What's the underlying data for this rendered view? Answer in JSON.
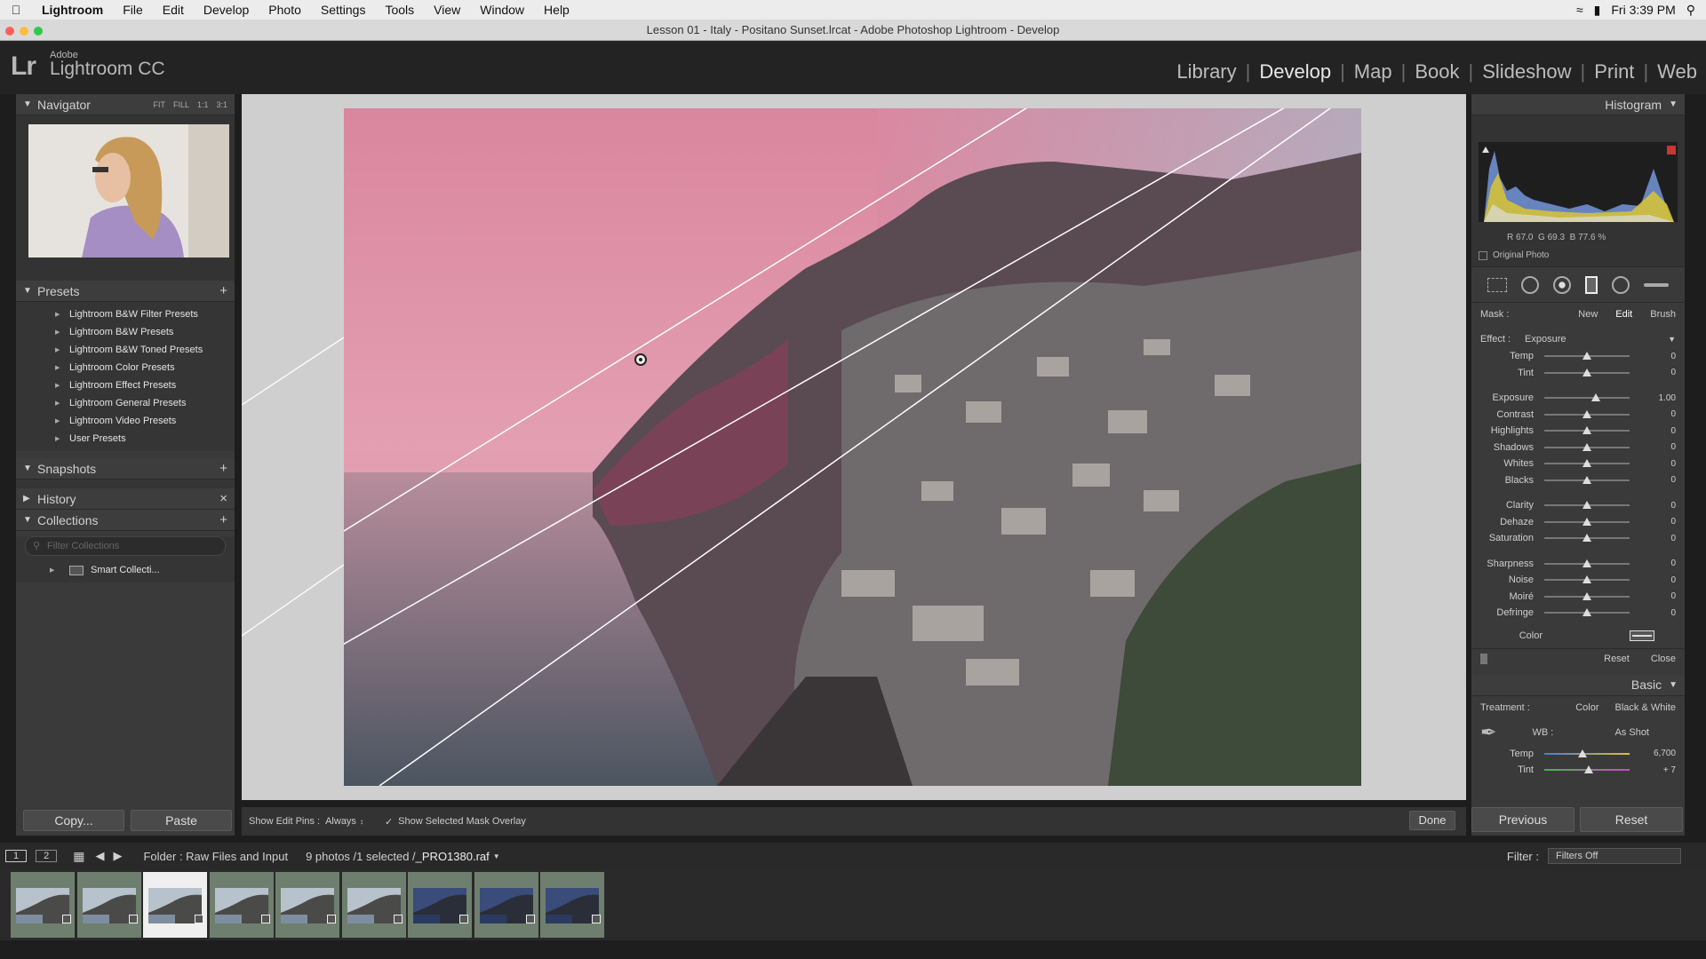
{
  "menubar": {
    "app": "Lightroom",
    "items": [
      "File",
      "Edit",
      "Develop",
      "Photo",
      "Settings",
      "Tools",
      "View",
      "Window",
      "Help"
    ],
    "clock": "Fri 3:39 PM"
  },
  "window": {
    "title": "Lesson 01 - Italy - Positano Sunset.lrcat - Adobe Photoshop Lightroom - Develop"
  },
  "header": {
    "logo": "Lr",
    "adobe": "Adobe",
    "product": "Lightroom CC",
    "modules": [
      "Library",
      "Develop",
      "Map",
      "Book",
      "Slideshow",
      "Print",
      "Web"
    ],
    "active_module": "Develop"
  },
  "left": {
    "navigator": {
      "title": "Navigator",
      "zoom": [
        "FIT",
        "FILL",
        "1:1",
        "3:1"
      ]
    },
    "presets": {
      "title": "Presets",
      "items": [
        "Lightroom B&W Filter Presets",
        "Lightroom B&W Presets",
        "Lightroom B&W Toned Presets",
        "Lightroom Color Presets",
        "Lightroom Effect Presets",
        "Lightroom General Presets",
        "Lightroom Video Presets",
        "User Presets"
      ]
    },
    "snapshots": "Snapshots",
    "history": "History",
    "collections": {
      "title": "Collections",
      "search_placeholder": "Filter Collections",
      "item": "Smart Collecti..."
    },
    "copy_label": "Copy...",
    "paste_label": "Paste"
  },
  "toolbar": {
    "show_pins_label": "Show Edit Pins :",
    "show_pins_value": "Always",
    "overlay_label": "Show Selected Mask Overlay",
    "done_label": "Done"
  },
  "right": {
    "histogram": {
      "title": "Histogram",
      "r": "67.0",
      "g": "69.3",
      "b": "77.6 %",
      "original_photo": "Original Photo"
    },
    "mask": {
      "label": "Mask :",
      "new": "New",
      "edit": "Edit",
      "brush": "Brush"
    },
    "effect": {
      "label": "Effect :",
      "value": "Exposure"
    },
    "sliders": [
      {
        "label": "Temp",
        "value": "0",
        "pos": 0.5
      },
      {
        "label": "Tint",
        "value": "0",
        "pos": 0.5
      },
      {
        "label": "Exposure",
        "value": "1.00",
        "pos": 0.6
      },
      {
        "label": "Contrast",
        "value": "0",
        "pos": 0.5
      },
      {
        "label": "Highlights",
        "value": "0",
        "pos": 0.5
      },
      {
        "label": "Shadows",
        "value": "0",
        "pos": 0.5
      },
      {
        "label": "Whites",
        "value": "0",
        "pos": 0.5
      },
      {
        "label": "Blacks",
        "value": "0",
        "pos": 0.5
      },
      {
        "label": "Clarity",
        "value": "0",
        "pos": 0.5
      },
      {
        "label": "Dehaze",
        "value": "0",
        "pos": 0.5
      },
      {
        "label": "Saturation",
        "value": "0",
        "pos": 0.5
      },
      {
        "label": "Sharpness",
        "value": "0",
        "pos": 0.5
      },
      {
        "label": "Noise",
        "value": "0",
        "pos": 0.5
      },
      {
        "label": "Moiré",
        "value": "0",
        "pos": 0.5
      },
      {
        "label": "Defringe",
        "value": "0",
        "pos": 0.5
      }
    ],
    "color_label": "Color",
    "reset_label": "Reset",
    "close_label": "Close",
    "basic": {
      "title": "Basic",
      "treatment_label": "Treatment :",
      "color": "Color",
      "bw": "Black & White",
      "wb_label": "WB :",
      "wb_value": "As Shot",
      "temp_label": "Temp",
      "temp_value": "6,700",
      "tint_label": "Tint",
      "tint_value": "+ 7"
    },
    "previous_label": "Previous",
    "reset_btn_label": "Reset"
  },
  "filmstrip": {
    "page1": "1",
    "page2": "2",
    "folder": "Folder : Raw Files and Input",
    "count": "9 photos /1 selected /",
    "filename": "_PRO1380.raf",
    "filter_label": "Filter :",
    "filter_value": "Filters Off",
    "thumb_count": 9,
    "selected_index": 2
  },
  "colors": {
    "accent": "#ffffff",
    "panel": "#3a3a3a",
    "background": "#1d1d1d"
  }
}
